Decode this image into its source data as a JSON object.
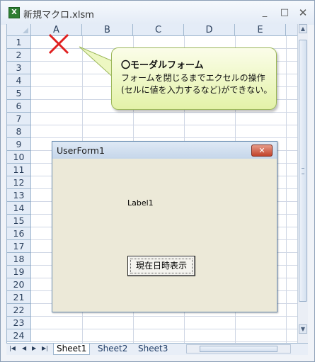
{
  "window": {
    "title": "新規マクロ.xlsm",
    "app_icon": "excel-icon",
    "min_label": "_",
    "max_label": "□",
    "close_label": "✕"
  },
  "columns": [
    "A",
    "B",
    "C",
    "D",
    "E"
  ],
  "rows": [
    "1",
    "2",
    "3",
    "4",
    "5",
    "6",
    "7",
    "8",
    "9",
    "10",
    "11",
    "12",
    "13",
    "14",
    "15",
    "16",
    "17",
    "18",
    "19",
    "20",
    "21",
    "22",
    "23",
    "24"
  ],
  "callout": {
    "title": "〇モーダルフォーム",
    "text": "フォームを閉じるまでエクセルの操作(セルに値を入力するなど)ができない。"
  },
  "userform": {
    "title": "UserForm1",
    "close_label": "✕",
    "label": "Label1",
    "button": "現在日時表示"
  },
  "sheet_tabs": [
    "Sheet1",
    "Sheet2",
    "Sheet3"
  ],
  "colors": {
    "accent_red": "#e02020",
    "callout_fill": "#eef8c4",
    "header_blue": "#e4ecf7"
  }
}
